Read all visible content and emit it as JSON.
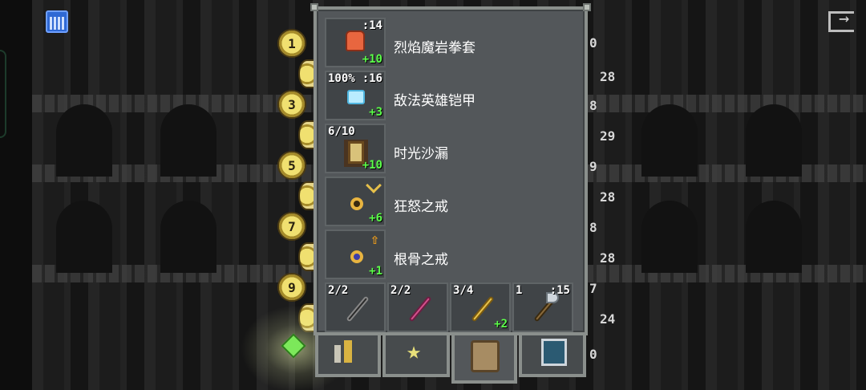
{
  "badges_left": [
    "1",
    "3",
    "5",
    "7",
    "9"
  ],
  "right_numbers": [
    "0",
    "28",
    "8",
    "29",
    "9",
    "28",
    "8",
    "28",
    "7",
    "24",
    "0"
  ],
  "inventory": {
    "rows": [
      {
        "name": "烈焰魔岩拳套",
        "top_right": ":14",
        "top_left": "",
        "upgrade": "+10",
        "icon": "fist-icon"
      },
      {
        "name": "敌法英雄铠甲",
        "top_right": ":16",
        "top_left": "100%",
        "upgrade": "+3",
        "icon": "armor-icon"
      },
      {
        "name": "时光沙漏",
        "top_right": "",
        "top_left": "6/10",
        "upgrade": "+10",
        "icon": "hourglass-icon"
      },
      {
        "name": "狂怒之戒",
        "top_right": "",
        "top_left": "",
        "upgrade": "+6",
        "icon": "ring-icon"
      },
      {
        "name": "根骨之戒",
        "top_right": "",
        "top_left": "",
        "upgrade": "+1",
        "icon": "ring-icon"
      }
    ],
    "quickslots": [
      {
        "top_left": "2/2",
        "top_right": "",
        "upgrade": "",
        "icon": "dark-wand-icon"
      },
      {
        "top_left": "2/2",
        "top_right": "",
        "upgrade": "",
        "icon": "pink-wand-icon"
      },
      {
        "top_left": "3/4",
        "top_right": "",
        "upgrade": "+2",
        "icon": "gold-wand-icon"
      },
      {
        "top_left": "1",
        "top_right": ":15",
        "upgrade": "",
        "icon": "axe-icon"
      }
    ]
  },
  "tabs": [
    {
      "icon": "bars-icon"
    },
    {
      "icon": "star-icon"
    },
    {
      "icon": "backpack-icon"
    },
    {
      "icon": "sword-icon"
    }
  ],
  "colors": {
    "upgrade": "#5cff4a",
    "window_bg": "#53575a",
    "badge": "#f0e070"
  }
}
